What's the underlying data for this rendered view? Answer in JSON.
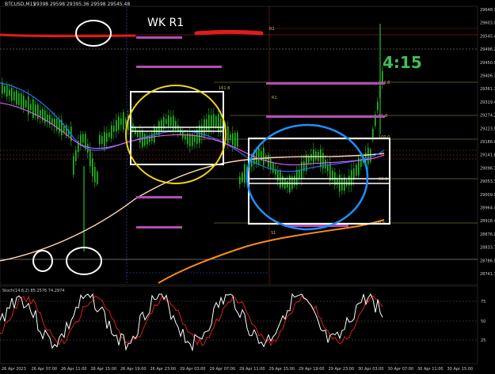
{
  "header": {
    "symbol": "BTCUSD,M15",
    "ohlc": "29398 29598 29395.36 29598 29545.48"
  },
  "annotations": {
    "wk_label": "WK R1",
    "time_label": "4:15"
  },
  "price_axis": {
    "ticks": [
      "29648.38",
      "29603.04",
      "29545.48",
      "29496.23",
      "29450.00",
      "29406.15",
      "29361.74",
      "29319.45",
      "29274.20",
      "29223.95",
      "29186.00",
      "29141.88",
      "29096.34",
      "29053.74",
      "29009.04",
      "28964.47",
      "28918.43",
      "28876.00",
      "28833.74",
      "28786.52",
      "28741.30"
    ]
  },
  "indicator": {
    "label": "Stoch(14,6,2) 85.2576 74.2974",
    "levels": [
      "75",
      "50",
      "25"
    ]
  },
  "time_axis": {
    "labels": [
      "26 Apr 2023",
      "26 Apr 07:00",
      "26 Apr 11:00",
      "26 Apr 15:00",
      "26 Apr 19:00",
      "26 Apr 23:00",
      "29 Apr 03:00",
      "29 Apr 07:00",
      "29 Apr 11:00",
      "29 Apr 15:00",
      "29 Apr 19:00",
      "29 Apr 23:00",
      "30 Apr 03:00",
      "30 Apr 07:00",
      "30 Apr 11:00",
      "30 Apr 15:00"
    ]
  },
  "fib_labels": [
    "R2",
    "161.8",
    "100.0",
    "R1",
    "61.8",
    "50.0",
    "38.2",
    "0.0",
    "S1"
  ],
  "colors": {
    "background": "#000000",
    "candles": "#22c122",
    "ma_blue": "#2a6bff",
    "ma_magenta": "#ff60ff",
    "ma_peach": "#ffd7b0",
    "ma_orange": "#ff8c1a",
    "pivot_purple": "#b44bb4",
    "wk_red": "#e01b1b",
    "yellow_circle": "#f2d21b",
    "blue_circle": "#1e90ff",
    "time_text": "#3fbf58",
    "stoch_white": "#ffffff",
    "stoch_red": "#d62020"
  }
}
